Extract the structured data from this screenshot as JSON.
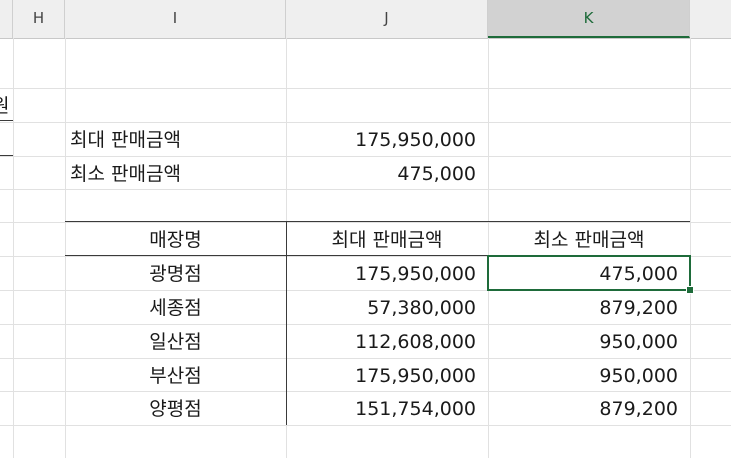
{
  "columns": [
    "H",
    "I",
    "J",
    "K"
  ],
  "selected_column": "K",
  "left_edge_glyph": "원",
  "summary": {
    "max_label": "최대 판매금액",
    "max_value": "175,950,000",
    "min_label": "최소 판매금액",
    "min_value": "475,000"
  },
  "table": {
    "headers": [
      "매장명",
      "최대 판매금액",
      "최소 판매금액"
    ],
    "rows": [
      [
        "광명점",
        "175,950,000",
        "475,000"
      ],
      [
        "세종점",
        "57,380,000",
        "879,200"
      ],
      [
        "일산점",
        "112,608,000",
        "950,000"
      ],
      [
        "부산점",
        "175,950,000",
        "950,000"
      ],
      [
        "양평점",
        "151,754,000",
        "879,200"
      ]
    ]
  },
  "colors": {
    "selection": "#1e6b3a",
    "header_bg": "#efefef"
  }
}
